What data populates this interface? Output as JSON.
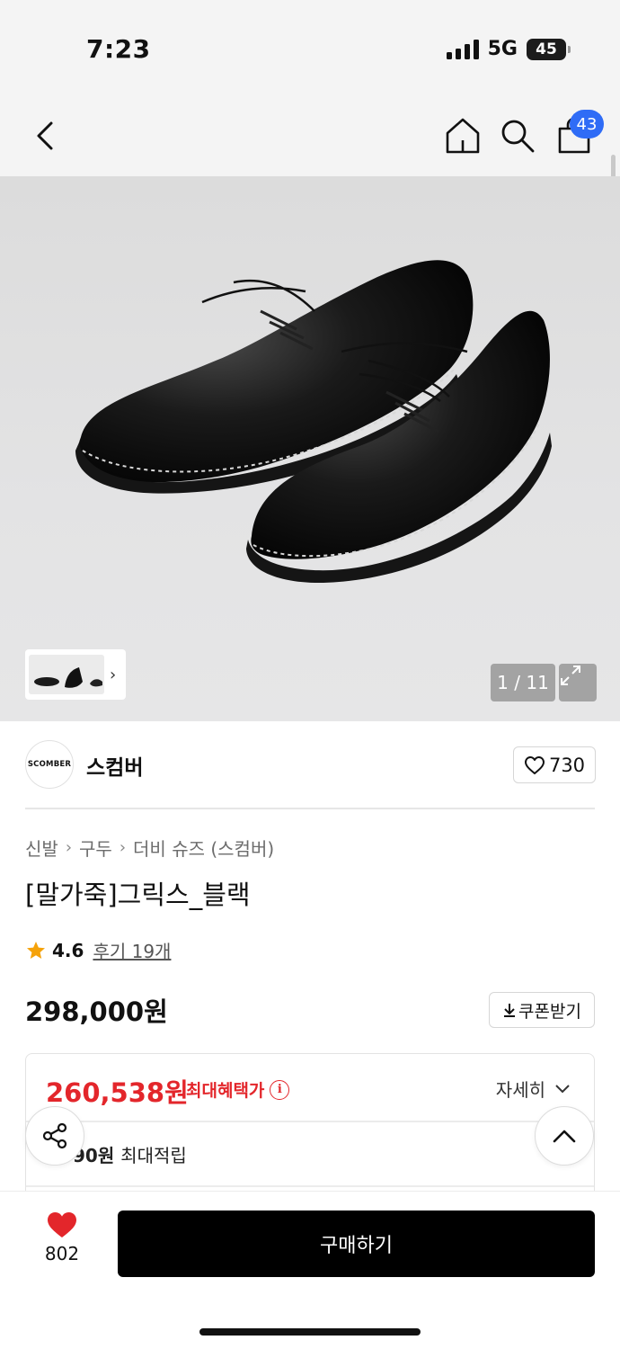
{
  "status_bar": {
    "time": "7:23",
    "network": "5G",
    "battery": "45"
  },
  "nav": {
    "cart_count": "43"
  },
  "gallery": {
    "counter": "1 / 11"
  },
  "brand": {
    "logo_text": "SCOMBER",
    "name": "스컴버",
    "likes": "730"
  },
  "breadcrumb": [
    "신발",
    "구두",
    "더비 슈즈 (스컴버)"
  ],
  "product": {
    "title": "[말가죽]그릭스_블랙",
    "rating": "4.6",
    "reviews": "후기 19개",
    "price": "298,000원",
    "coupon_label": "쿠폰받기"
  },
  "benefit": {
    "max_price": "260,538원",
    "max_price_label": "최대혜택가",
    "detail_label": "자세히",
    "points_prefix": "90원",
    "points_label": "최대적립"
  },
  "bottom": {
    "wish_count": "802",
    "buy_label": "구매하기"
  },
  "colors": {
    "accent_red": "#e3262b",
    "badge_blue": "#2f6cf6",
    "star": "#f5a20a"
  }
}
